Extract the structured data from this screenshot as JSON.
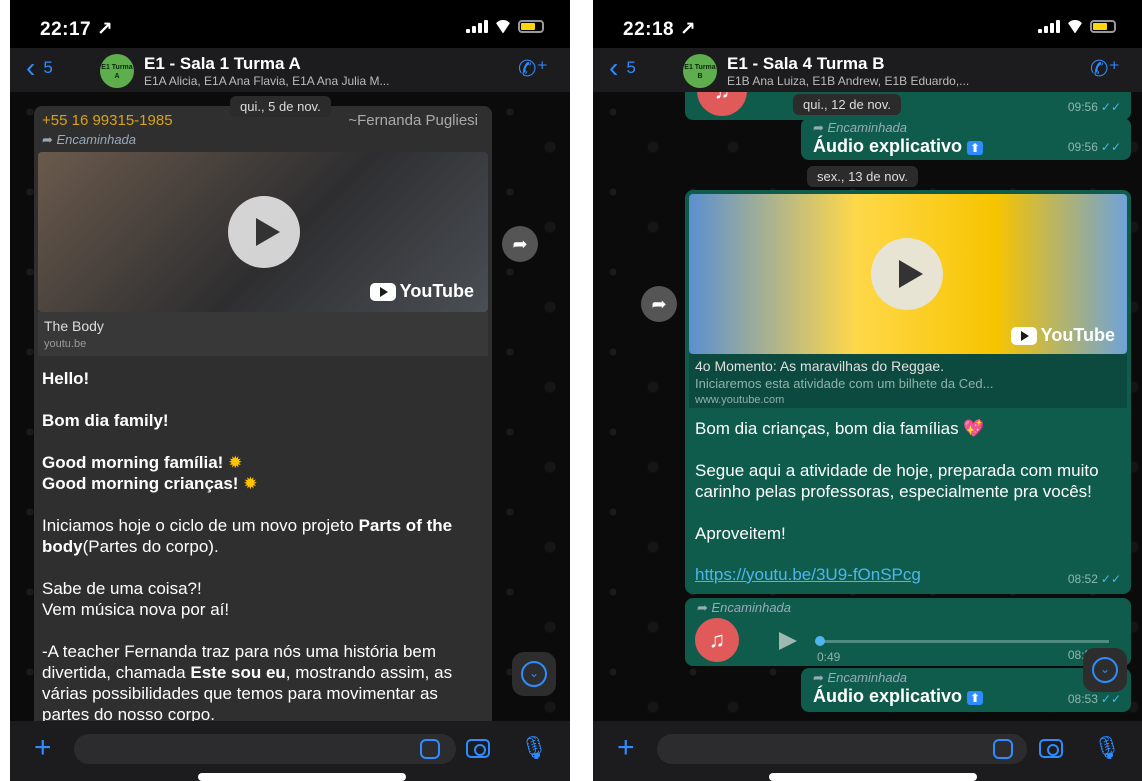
{
  "left": {
    "status_time": "22:17 ↗",
    "back_count": "5",
    "group_avatar_text": "E1 Turma A",
    "group_title": "E1 - Sala 1 Turma A",
    "group_members": "E1A Alicia, E1A Ana Flavia, E1A Ana Julia M...",
    "date_chip": "qui., 5 de nov.",
    "sender_phone": "+55 16 99315-1985",
    "sender_name": "~Fernanda Pugliesi",
    "forwarded": "Encaminhada",
    "link_title": "The Body",
    "link_domain": "youtu.be",
    "youtube_label": "YouTube",
    "msg_hello": "Hello!",
    "msg_family": "Bom dia family!",
    "msg_gm1": "Good morning família!",
    "msg_gm2": "Good morning crianças!",
    "msg_p1a": "Iniciamos hoje  o ciclo de um novo projeto ",
    "msg_p1b": "Parts of the body",
    "msg_p1c": "(Partes do corpo).",
    "msg_p2a": "Sabe de uma coisa?!",
    "msg_p2b": "Vem música nova por aí!",
    "msg_p3a": "-A teacher Fernanda  traz para nós uma história bem divertida, chamada ",
    "msg_p3b": "Este sou eu",
    "msg_p3c": ", mostrando assim, as várias possibilidades que temos para movimentar as partes do nosso corpo."
  },
  "right": {
    "status_time": "22:18 ↗",
    "back_count": "5",
    "group_avatar_text": "E1 Turma B",
    "group_title": "E1 - Sala 4 Turma B",
    "group_members": "E1B Ana Luiza, E1B Andrew, E1B Eduardo,...",
    "date_chip_1": "qui., 12 de nov.",
    "time_1": "09:56",
    "forwarded": "Encaminhada",
    "audio_label": "Áudio explicativo",
    "time_2": "09:56",
    "date_chip_2": "sex., 13 de nov.",
    "youtube_label": "YouTube",
    "link_title": "4o Momento: As maravilhas do Reggae.",
    "link_desc": "Iniciaremos esta atividade com um bilhete da Ced...",
    "link_domain": "www.youtube.com",
    "msg_p1": "Bom dia crianças, bom dia famílias",
    "msg_p2": "Segue aqui a atividade de hoje, preparada com muito carinho pelas professoras, especialmente pra vocês!",
    "msg_p3": "Aproveitem!",
    "msg_link": "https://youtu.be/3U9-fOnSPcg",
    "time_3": "08:52",
    "audio_duration": "0:49",
    "time_4": "08:52",
    "time_5": "08:53"
  }
}
